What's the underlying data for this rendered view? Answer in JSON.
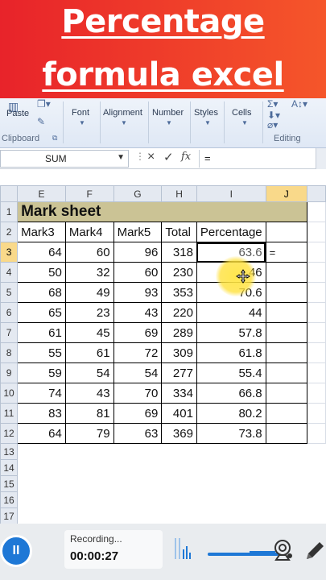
{
  "banner": {
    "line1": "Percentage",
    "line2": "formula excel"
  },
  "ribbon": {
    "paste_label": "Paste",
    "clipboard_label": "Clipboard",
    "font_label": "Font",
    "alignment_label": "Alignment",
    "number_label": "Number",
    "styles_label": "Styles",
    "cells_label": "Cells",
    "editing_label": "Editing"
  },
  "formula_bar": {
    "name_box": "SUM",
    "cancel_icon": "×",
    "enter_icon": "✓",
    "fx_icon": "fx",
    "formula": "="
  },
  "sheet": {
    "columns": [
      "E",
      "F",
      "G",
      "H",
      "I",
      "J"
    ],
    "title": "Mark sheet",
    "headers": [
      "Mark3",
      "Mark4",
      "Mark5",
      "Total",
      "Percentage"
    ],
    "rows": [
      [
        "64",
        "60",
        "96",
        "318",
        "63.6"
      ],
      [
        "50",
        "32",
        "60",
        "230",
        "46"
      ],
      [
        "68",
        "49",
        "93",
        "353",
        "70.6"
      ],
      [
        "65",
        "23",
        "43",
        "220",
        "44"
      ],
      [
        "61",
        "45",
        "69",
        "289",
        "57.8"
      ],
      [
        "55",
        "61",
        "72",
        "309",
        "61.8"
      ],
      [
        "59",
        "54",
        "54",
        "277",
        "55.4"
      ],
      [
        "74",
        "43",
        "70",
        "334",
        "66.8"
      ],
      [
        "83",
        "81",
        "69",
        "401",
        "80.2"
      ],
      [
        "64",
        "79",
        "63",
        "369",
        "73.8"
      ]
    ],
    "editing_value": "=",
    "row_numbers": [
      "1",
      "2",
      "3",
      "4",
      "5",
      "6",
      "7",
      "8",
      "9",
      "10",
      "11",
      "12",
      "13",
      "14",
      "15",
      "16",
      "17"
    ]
  },
  "recorder": {
    "status": "Recording...",
    "time": "00:00:27",
    "pause_icon": "II"
  },
  "colors": {
    "banner": "#e8232a",
    "title_fill": "#cbc395",
    "highlight": "#ffe146",
    "accent": "#1e78d6"
  }
}
